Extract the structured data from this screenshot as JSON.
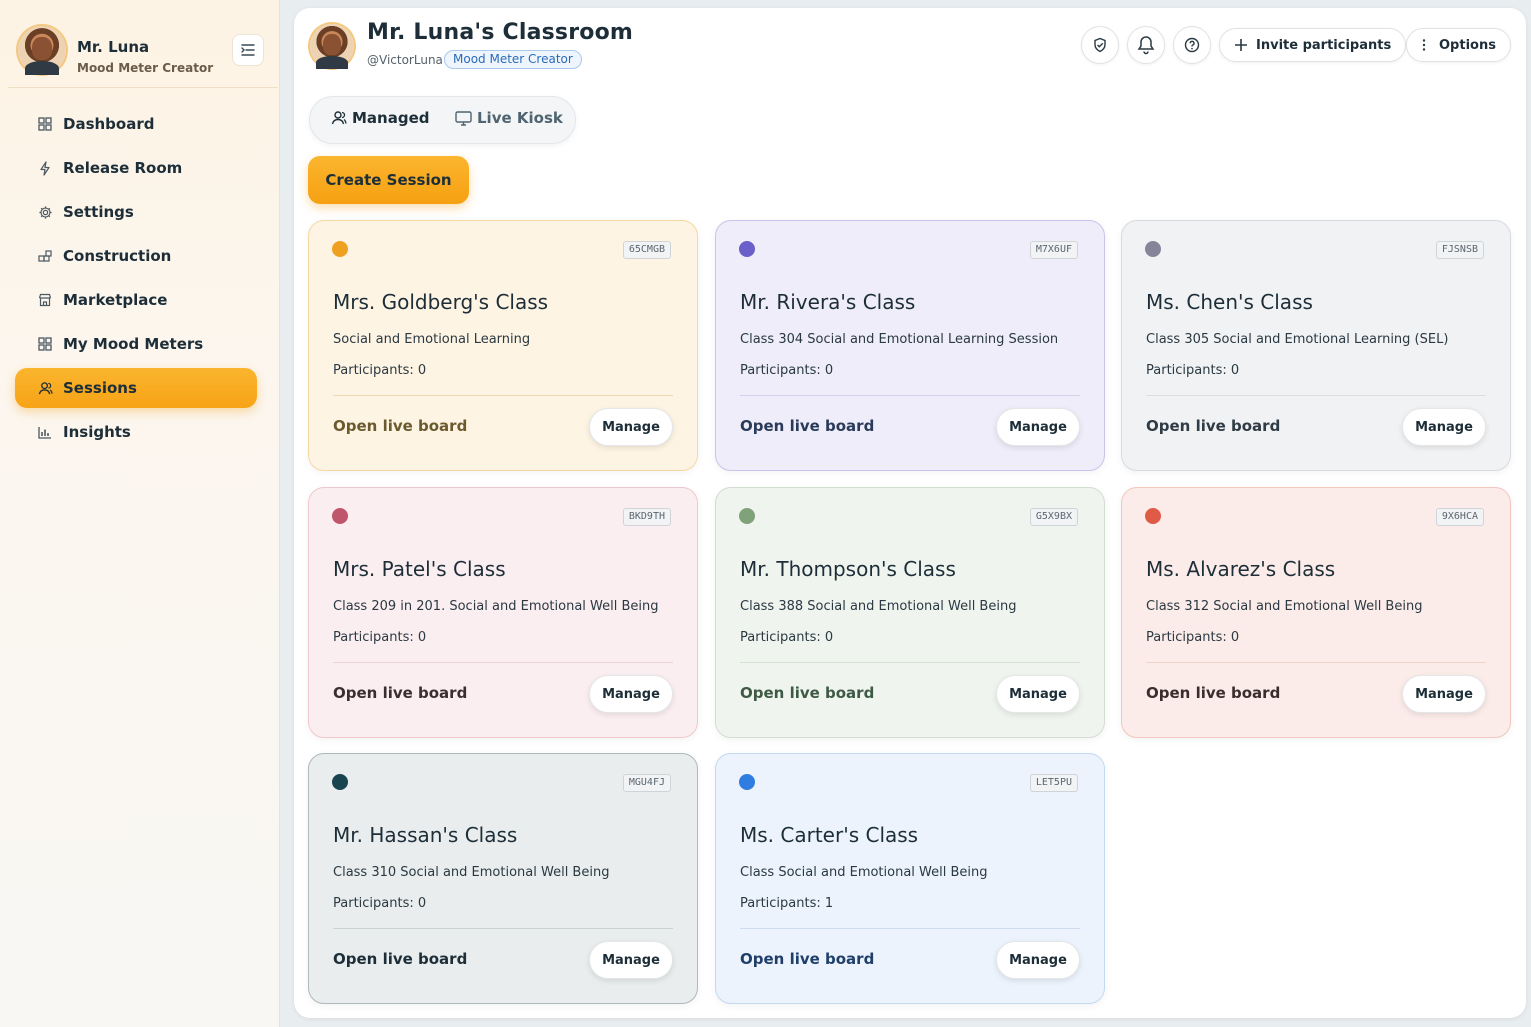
{
  "sidebar": {
    "profile": {
      "name": "Mr. Luna",
      "role": "Mood Meter Creator"
    },
    "items": [
      {
        "label": "Dashboard",
        "icon": "grid-icon",
        "active": false
      },
      {
        "label": "Release Room",
        "icon": "lightning-icon",
        "active": false
      },
      {
        "label": "Settings",
        "icon": "gear-icon",
        "active": false
      },
      {
        "label": "Construction",
        "icon": "blocks-icon",
        "active": false
      },
      {
        "label": "Marketplace",
        "icon": "store-icon",
        "active": false
      },
      {
        "label": "My Mood Meters",
        "icon": "grid-icon",
        "active": false
      },
      {
        "label": "Sessions",
        "icon": "users-icon",
        "active": true
      },
      {
        "label": "Insights",
        "icon": "bar-chart-icon",
        "active": false
      }
    ]
  },
  "header": {
    "title": "Mr. Luna's Classroom",
    "handle": "@VictorLuna",
    "role_badge": "Mood Meter Creator",
    "invite_label": "Invite participants",
    "options_label": "Options"
  },
  "tabs": {
    "managed": "Managed",
    "kiosk": "Live Kiosk",
    "active": "managed"
  },
  "create_label": "Create Session",
  "card_actions": {
    "open": "Open live board",
    "manage": "Manage"
  },
  "sessions": [
    {
      "name": "Mrs. Goldberg's Class",
      "code": "65CMGB",
      "description": "Social and Emotional Learning",
      "participants": "Participants: 0",
      "dot_color": "#f0a020",
      "bg": "#fdf4e3",
      "border": "#f6d8a4",
      "divider": "#efd7b0",
      "open_color": "#6b5a2e"
    },
    {
      "name": "Mr. Rivera's Class",
      "code": "M7X6UF",
      "description": "Class 304 Social and Emotional Learning Session",
      "participants": "Participants: 0",
      "dot_color": "#6b5fc9",
      "bg": "#eeedf9",
      "border": "#c8c4ec",
      "divider": "#d4d2ea",
      "open_color": "#2a3a5a"
    },
    {
      "name": "Ms. Chen's Class",
      "code": "FJSNSB",
      "description": "Class 305 Social and Emotional Learning (SEL)",
      "participants": "Participants: 0",
      "dot_color": "#858499",
      "bg": "#f1f2f4",
      "border": "#d8dadf",
      "divider": "#dcdee2",
      "open_color": "#2f3b45"
    },
    {
      "name": "Mrs. Patel's Class",
      "code": "BKD9TH",
      "description": "Class 209 in 201. Social and Emotional Well Being",
      "participants": "Participants: 0",
      "dot_color": "#c0566a",
      "bg": "#fbeef0",
      "border": "#f0c8cf",
      "divider": "#ecd2d6",
      "open_color": "#3a2e33"
    },
    {
      "name": "Mr. Thompson's Class",
      "code": "G5X9BX",
      "description": "Class 388 Social and Emotional Well Being",
      "participants": "Participants: 0",
      "dot_color": "#7fa278",
      "bg": "#f0f4ef",
      "border": "#d3ddd1",
      "divider": "#d7e0d5",
      "open_color": "#3e5a44"
    },
    {
      "name": "Ms. Alvarez's Class",
      "code": "9X6HCA",
      "description": "Class 312 Social and Emotional Well Being",
      "participants": "Participants: 0",
      "dot_color": "#e05a48",
      "bg": "#fcece9",
      "border": "#f3c6be",
      "divider": "#efd0ca",
      "open_color": "#3a2e2c"
    },
    {
      "name": "Mr. Hassan's Class",
      "code": "MGU4FJ",
      "description": "Class 310 Social and Emotional Well Being",
      "participants": "Participants: 0",
      "dot_color": "#184450",
      "bg": "#e9edee",
      "border": "#aeb9bd",
      "divider": "#c9d1d4",
      "open_color": "#1d2e38"
    },
    {
      "name": "Ms. Carter's Class",
      "code": "LET5PU",
      "description": "Class Social and Emotional Well Being",
      "participants": "Participants: 1",
      "dot_color": "#2f7de0",
      "bg": "#ecf3fc",
      "border": "#c1d9f3",
      "divider": "#cddcef",
      "open_color": "#1f3f6a"
    }
  ]
}
